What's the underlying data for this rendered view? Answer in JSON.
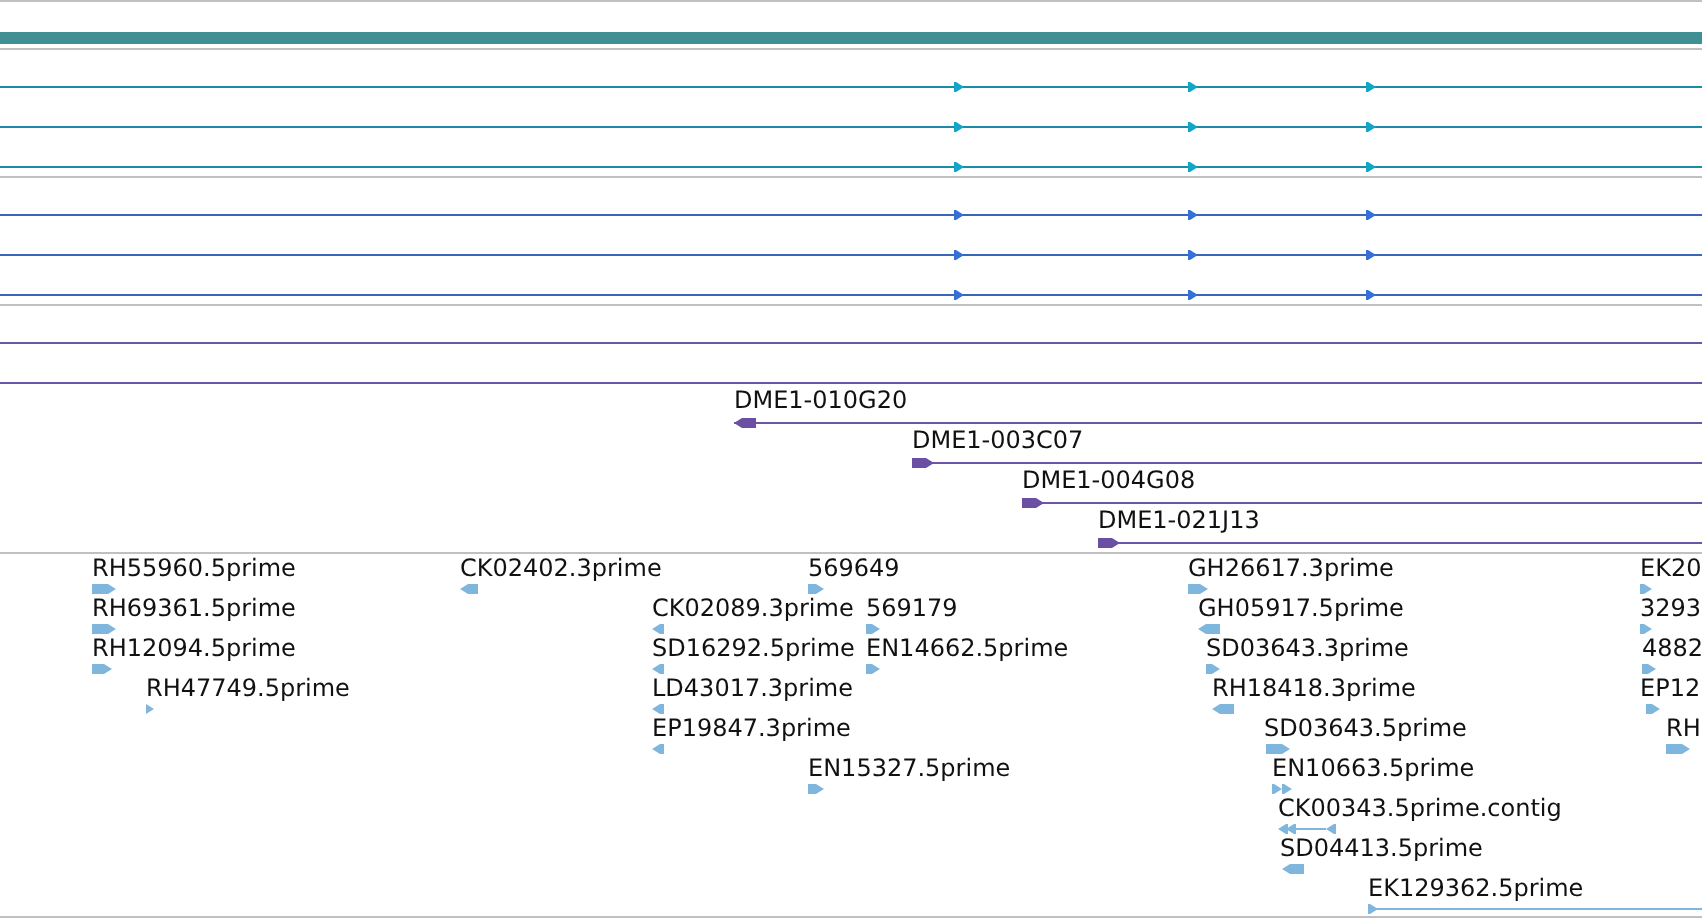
{
  "clones": [
    {
      "label": "DME1-010G20",
      "reverse": true
    },
    {
      "label": "DME1-003C07",
      "reverse": false
    },
    {
      "label": "DME1-004G08",
      "reverse": false
    },
    {
      "label": "DME1-021J13",
      "reverse": false
    }
  ],
  "ests": [
    {
      "label": "RH55960.5prime",
      "reverse": false
    },
    {
      "label": "RH69361.5prime",
      "reverse": false
    },
    {
      "label": "RH12094.5prime",
      "reverse": false
    },
    {
      "label": "RH47749.5prime",
      "reverse": false
    },
    {
      "label": "CK02402.3prime",
      "reverse": true
    },
    {
      "label": "CK02089.3prime",
      "reverse": true
    },
    {
      "label": "SD16292.5prime",
      "reverse": true
    },
    {
      "label": "LD43017.3prime",
      "reverse": true
    },
    {
      "label": "EP19847.3prime",
      "reverse": true
    },
    {
      "label": "569649",
      "reverse": false
    },
    {
      "label": "569179",
      "reverse": false
    },
    {
      "label": "EN14662.5prime",
      "reverse": false
    },
    {
      "label": "EN15327.5prime",
      "reverse": false
    },
    {
      "label": "GH26617.3prime",
      "reverse": false
    },
    {
      "label": "GH05917.5prime",
      "reverse": true
    },
    {
      "label": "SD03643.3prime",
      "reverse": false
    },
    {
      "label": "RH18418.3prime",
      "reverse": true
    },
    {
      "label": "SD03643.5prime",
      "reverse": false
    },
    {
      "label": "EN10663.5prime",
      "reverse": false
    },
    {
      "label": "CK00343.5prime.contig",
      "reverse": true
    },
    {
      "label": "SD04413.5prime",
      "reverse": true
    },
    {
      "label": "EK129362.5prime",
      "reverse": false
    },
    {
      "label": "EK20",
      "reverse": false
    },
    {
      "label": "3293",
      "reverse": false
    },
    {
      "label": "4882",
      "reverse": false
    },
    {
      "label": "EP12",
      "reverse": false
    },
    {
      "label": "RH",
      "reverse": false
    }
  ]
}
